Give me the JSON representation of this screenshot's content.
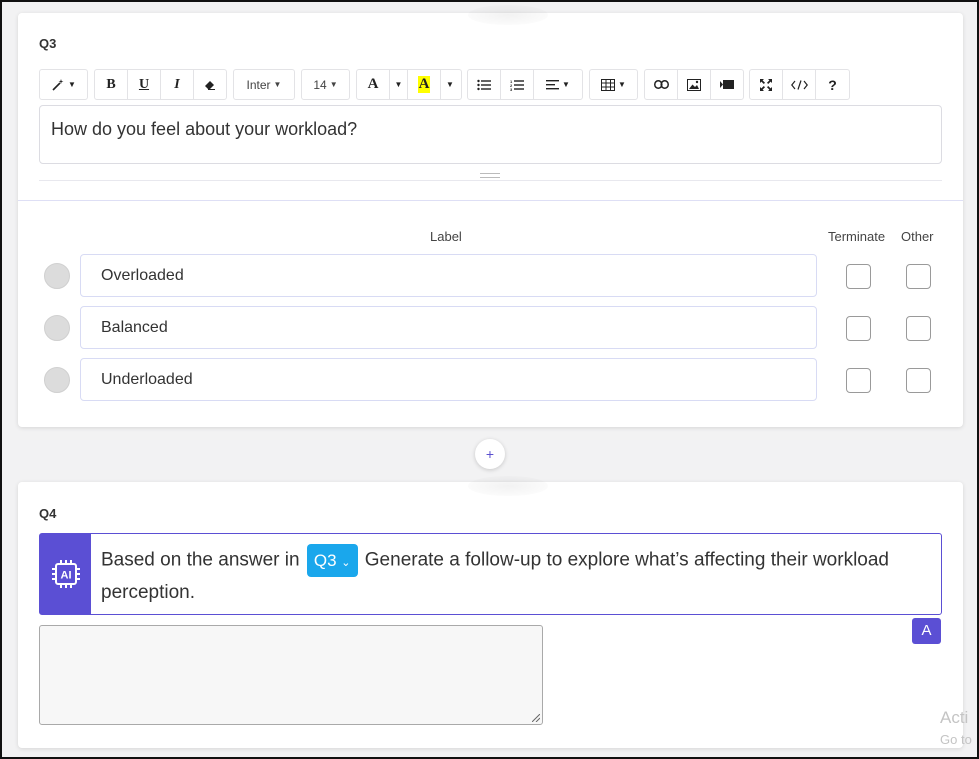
{
  "q3": {
    "label": "Q3",
    "toolbar": {
      "font_name": "Inter",
      "font_size": "14",
      "bold": "B",
      "underline": "U",
      "italic": "I",
      "font_color": "A",
      "highlight": "A",
      "help": "?"
    },
    "question_text": "How do you feel about your workload?",
    "columns": {
      "label": "Label",
      "terminate": "Terminate",
      "other": "Other"
    },
    "options": [
      {
        "label": "Overloaded"
      },
      {
        "label": "Balanced"
      },
      {
        "label": "Underloaded"
      }
    ]
  },
  "add_button": "+",
  "q4": {
    "label": "Q4",
    "ai_prompt": {
      "prefix": "Based on the answer in",
      "ref": "Q3",
      "suffix": "Generate a follow-up to explore what’s affecting their workload perception."
    },
    "ai_badge_text": "AI",
    "a_button": "A"
  },
  "watermark": {
    "line1": "Acti",
    "line2": "Go to"
  },
  "colors": {
    "accent": "#5b4fd4",
    "ref_chip": "#1aa7ec"
  }
}
